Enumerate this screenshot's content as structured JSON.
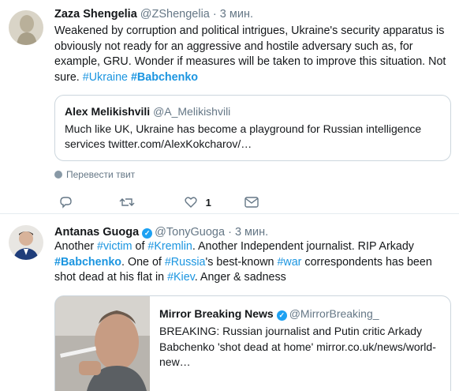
{
  "tweets": [
    {
      "name": "Zaza Shengelia",
      "handle": "@ZShengelia",
      "dot": "·",
      "time": "3 мин.",
      "text": "Weakened by corruption and political intrigues, Ukraine's security apparatus is obviously not ready for an aggressive and hostile adversary such as, for example, GRU. Wonder if measures will be taken to improve this situation. Not sure.",
      "hashtags": [
        "#Ukraine",
        "#Babchenko"
      ],
      "quote": {
        "name": "Alex Melikishvili",
        "handle": "@A_Melikishvili",
        "text": "Much like UK, Ukraine has become a playground for Russian intelligence services twitter.com/AlexKokcharov/…"
      },
      "translate_label": "Перевести твит",
      "like_count": "1"
    },
    {
      "name": "Antanas Guoga",
      "handle": "@TonyGuoga",
      "dot": "·",
      "time": "3 мин.",
      "text_parts": {
        "p1": "Another ",
        "tag_victim": "#victim",
        "p2": " of ",
        "tag_kremlin": "#Kremlin",
        "p3": ". Another Independent journalist. RIP Arkady ",
        "tag_babchenko": "#Babchenko",
        "p4": ". One of ",
        "tag_russia": "#Russia",
        "p5": "'s best-known ",
        "tag_war": "#war",
        "p6": " correspondents has been shot dead at his flat in ",
        "tag_kiev": "#Kiev",
        "p7": ". Anger & sadness"
      },
      "quote": {
        "name": "Mirror Breaking News",
        "handle": "@MirrorBreaking_",
        "text": "BREAKING: Russian journalist and Putin critic Arkady Babchenko 'shot dead at home' mirror.co.uk/news/world-new…"
      }
    }
  ],
  "colors": {
    "accent": "#1b95e0",
    "verified": "#1da1f2",
    "muted": "#657786",
    "border": "#ccd6dd"
  },
  "icons": [
    "reply-icon",
    "retweet-icon",
    "like-icon",
    "dm-icon",
    "globe-icon",
    "verified-icon"
  ]
}
